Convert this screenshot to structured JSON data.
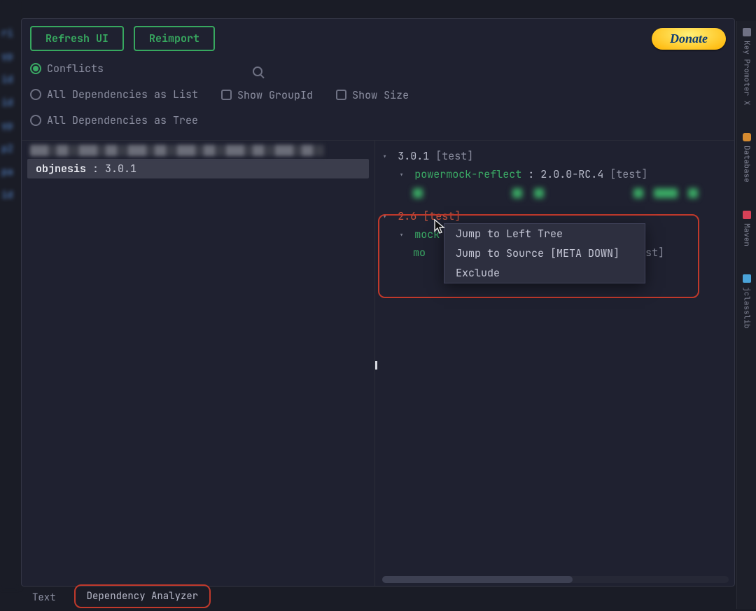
{
  "toolbar": {
    "refresh_label": "Refresh UI",
    "reimport_label": "Reimport",
    "donate_label": "Donate"
  },
  "viewmode": {
    "conflicts": "Conflicts",
    "list": "All Dependencies as List",
    "tree": "All Dependencies as Tree"
  },
  "checks": {
    "groupid": "Show GroupId",
    "size": "Show Size"
  },
  "left": {
    "selected_name": "objnesis",
    "selected_sep": " : ",
    "selected_ver": "3.0.1"
  },
  "tree": {
    "n0_version": "3.0.1",
    "n0_scope": "[test]",
    "n1_name": "powermock-reflect",
    "n1_sep": " : ",
    "n1_version": "2.0.0-RC.4",
    "n1_scope": "[test]",
    "n2_version": "2.6",
    "n2_scope": "[test]",
    "n3_name": "mock",
    "n4_prefix": "mo",
    "n4_scope_tail": "st]"
  },
  "menu": {
    "jump_left": "Jump to Left Tree",
    "jump_src": "Jump to Source [META DOWN]",
    "exclude": "Exclude"
  },
  "bottom": {
    "text_tab": "Text",
    "analyzer_tab": "Dependency Analyzer"
  },
  "right_strip": {
    "keypromoter": "Key Promoter X",
    "database": "Database",
    "maven": "Maven",
    "jclasslib": "jclasslib"
  }
}
